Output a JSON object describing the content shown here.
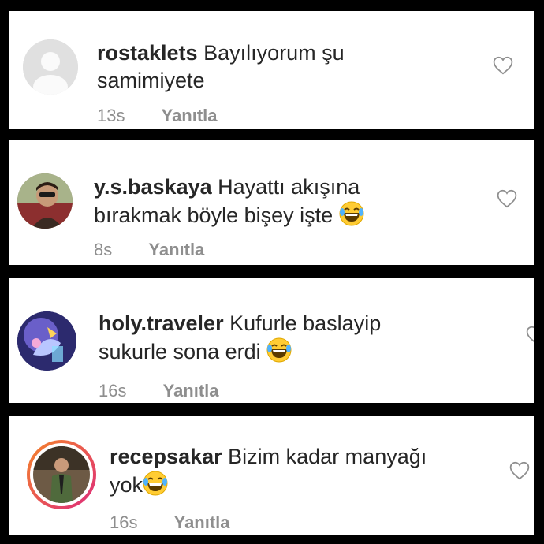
{
  "comments": [
    {
      "username": "rostaklets",
      "text_line1": "Bayılıyorum şu",
      "text_line2": "samimiyete",
      "time": "13s",
      "reply": "Yanıtla",
      "avatar": "default-user-avatar",
      "emoji": ""
    },
    {
      "username": "y.s.baskaya",
      "text_line1": "Hayattı akışına",
      "text_line2": "bırakmak böyle bişey işte",
      "time": "8s",
      "reply": "Yanıtla",
      "avatar": "profile-photo",
      "emoji": "laughing-tears-emoji"
    },
    {
      "username": "holy.traveler",
      "text_line1": "Kufurle baslayip",
      "text_line2": "sukurle sona erdi",
      "time": "16s",
      "reply": "Yanıtla",
      "avatar": "profile-photo",
      "emoji": "laughing-tears-emoji"
    },
    {
      "username": "recepsakar",
      "text_line1": "Bizim kadar manyağı",
      "text_line2": "yok",
      "time": "16s",
      "reply": "Yanıtla",
      "avatar": "story-ring-profile-photo",
      "emoji": "laughing-tears-emoji"
    }
  ],
  "icons": {
    "like": "heart-outline-icon"
  },
  "colors": {
    "text": "#262626",
    "meta": "#8e8e8e",
    "frame": "#000000",
    "story_ring_start": "#f58529",
    "story_ring_end": "#dd2a7b"
  }
}
